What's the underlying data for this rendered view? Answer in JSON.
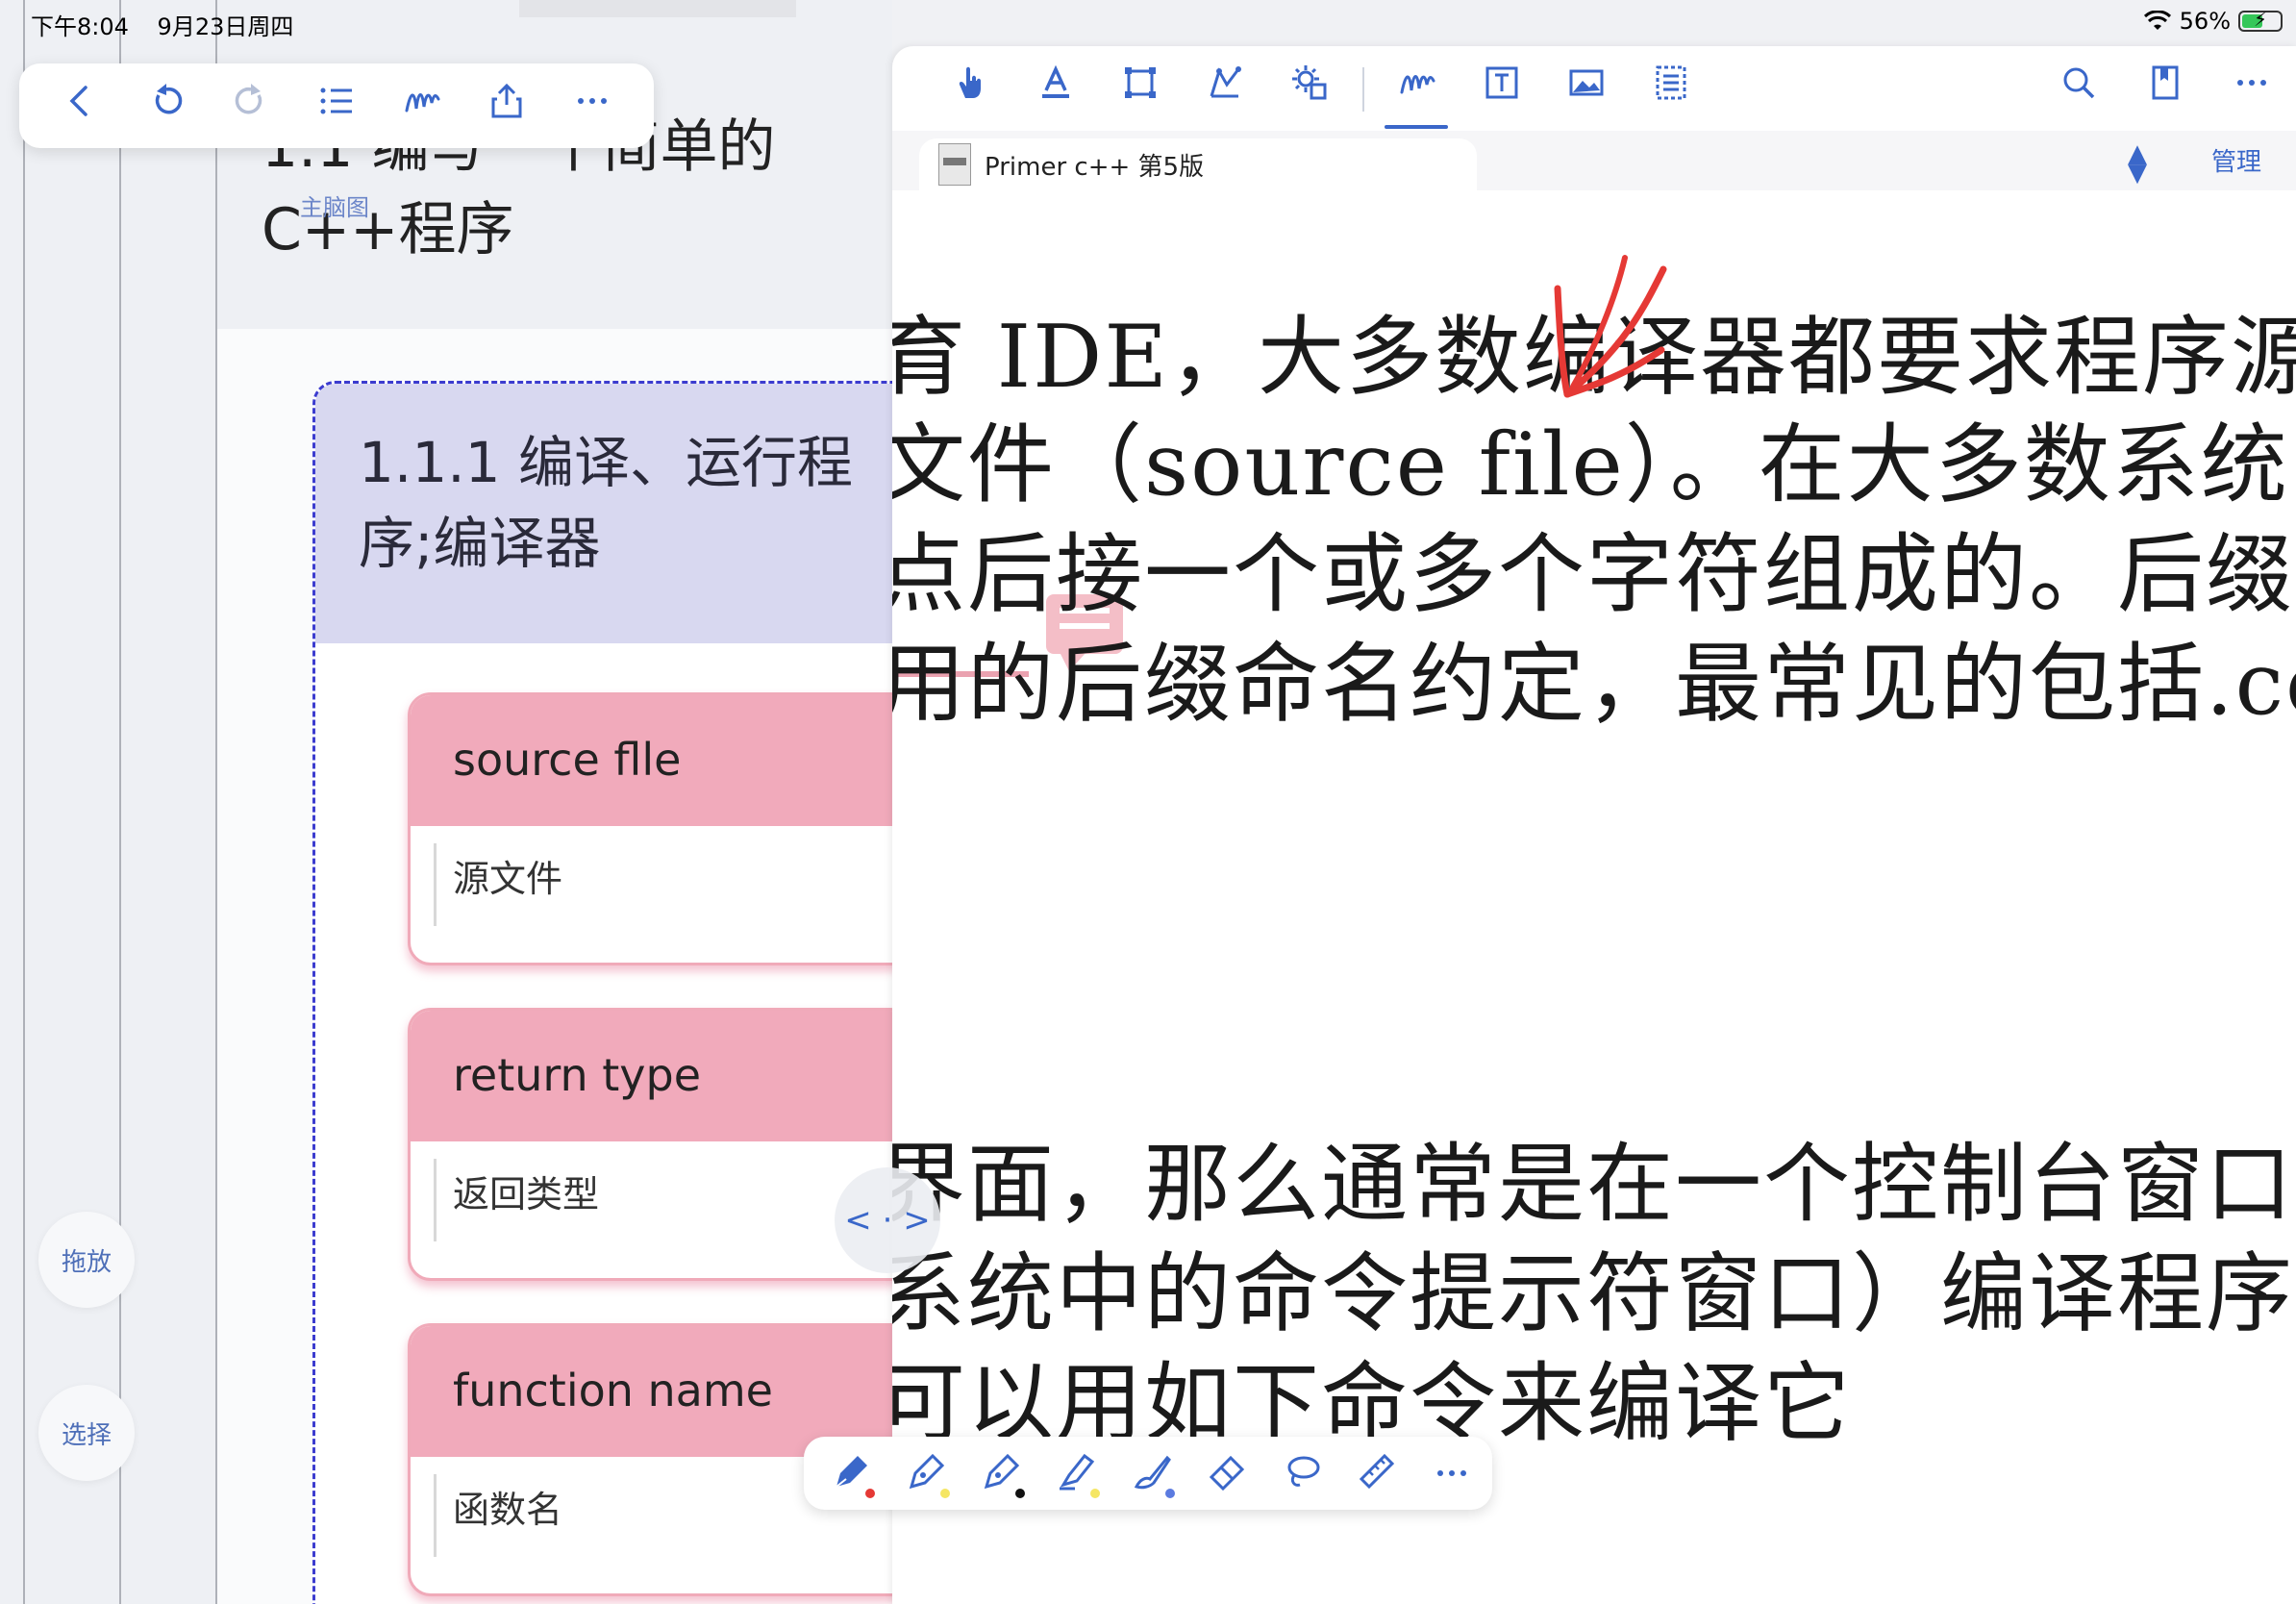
{
  "status_bar": {
    "time": "下午8:04",
    "date": "9月23日周四",
    "battery": "56%",
    "battery_level": 0.56
  },
  "mindmap_toolbar": {
    "icons": [
      "back-icon",
      "undo-icon",
      "redo-icon",
      "outline-list-icon",
      "pen-scribble-icon",
      "share-icon",
      "more-icon"
    ]
  },
  "mindmap": {
    "heading": "1.1 编写一个简单的C++程序",
    "tag": "主脑图",
    "topic": {
      "title": "1.1.1 编译、运行程序;编译器"
    },
    "cards": [
      {
        "term": "source flle",
        "meaning": "源文件"
      },
      {
        "term": "return type",
        "meaning": "返回类型"
      },
      {
        "term": "function name",
        "meaning": "函数名"
      }
    ],
    "side_buttons": {
      "drag": "拖放",
      "select": "选择"
    }
  },
  "pdf_toolbar": {
    "tools": [
      "hand-icon",
      "text-highlight-icon",
      "rect-select-icon",
      "shape-icon",
      "settings-gear-icon",
      "pen-scribble-icon",
      "text-box-icon",
      "image-icon",
      "page-outline-icon"
    ],
    "right": [
      "search-icon",
      "bookmark-icon",
      "more-icon"
    ]
  },
  "document": {
    "tab_title": "Primer c++ 第5版",
    "manage_label": "管理"
  },
  "pdf_text": {
    "lines": [
      "育 IDE，大多数编译器都要求程序源",
      "文件（source file）。在大多数系统中",
      "点后接一个或多个字符组成的。后缀",
      "用的后缀命名约定，最常见的包括.cc、",
      "界面，那么通常是在一个控制台窗口",
      "系统中的命令提示符窗口）编译程序",
      "可以用如下命令来编译它"
    ]
  },
  "split_handle": "< · >",
  "pen_toolbar": {
    "tools": [
      {
        "name": "fountain-pen-icon",
        "color": "#e53935"
      },
      {
        "name": "pen-icon",
        "color": "#f5e663"
      },
      {
        "name": "pen-icon",
        "color": "#111111"
      },
      {
        "name": "highlighter-icon",
        "color": "#f5e663"
      },
      {
        "name": "brush-icon",
        "color": "#5b7be0"
      },
      {
        "name": "eraser-icon",
        "color": ""
      },
      {
        "name": "lasso-icon",
        "color": ""
      },
      {
        "name": "ruler-icon",
        "color": ""
      },
      {
        "name": "more-icon",
        "color": ""
      }
    ]
  }
}
